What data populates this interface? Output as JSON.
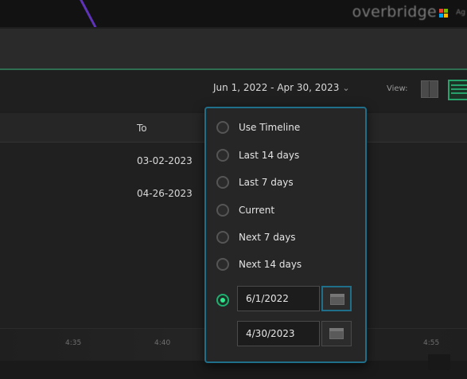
{
  "header": {
    "brand": "overbridge",
    "brand_suffix": "Ag",
    "brand_logo_colors": [
      "#e34133",
      "#7fba00",
      "#00a4ef",
      "#ffb900"
    ]
  },
  "toolbar": {
    "date_range": "Jun 1, 2022 - Apr 30, 2023",
    "chevron_icon": "chevron-down-icon",
    "view_label": "View:",
    "view_modes": [
      "grid-view-icon",
      "list-view-icon"
    ],
    "active_view": "list"
  },
  "table": {
    "columns": [
      "To"
    ],
    "rows": [
      {
        "to": "03-02-2023"
      },
      {
        "to": "04-26-2023"
      }
    ]
  },
  "timeline": {
    "ticks": [
      "4:35",
      "4:40",
      "4:55"
    ]
  },
  "date_menu": {
    "options": [
      {
        "label": "Use Timeline",
        "selected": false
      },
      {
        "label": "Last 14 days",
        "selected": false
      },
      {
        "label": "Last 7 days",
        "selected": false
      },
      {
        "label": "Current",
        "selected": false
      },
      {
        "label": "Next 7 days",
        "selected": false
      },
      {
        "label": "Next 14 days",
        "selected": false
      }
    ],
    "custom": {
      "selected": true,
      "from": "6/1/2022",
      "to": "4/30/2023",
      "calendar_icon": "calendar-icon"
    }
  },
  "colors": {
    "accent": "#25a36a",
    "focus": "#1f6f8b",
    "radio_on": "#2ee88e",
    "background": "#1e1e1e"
  }
}
